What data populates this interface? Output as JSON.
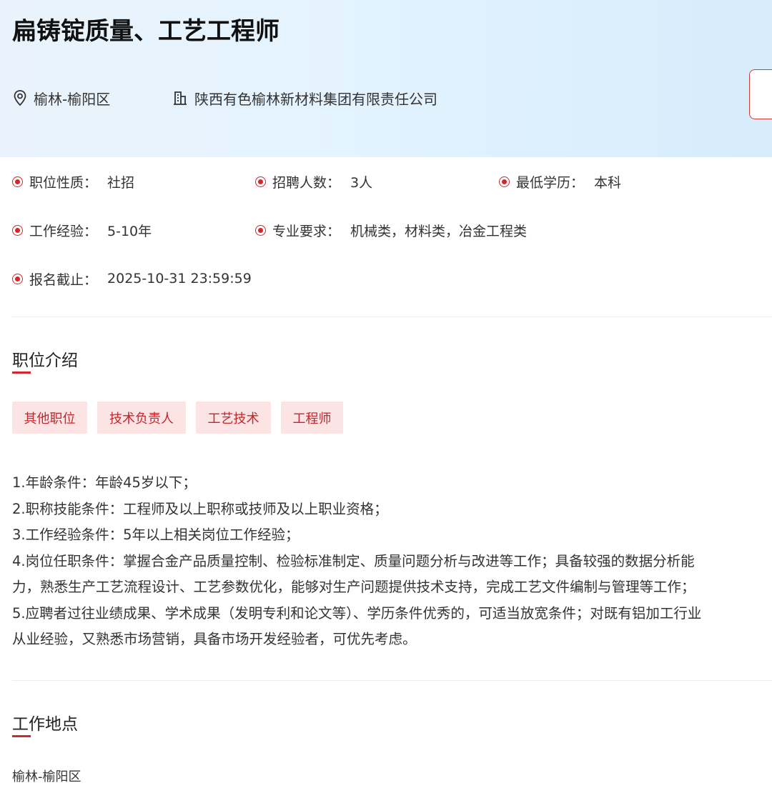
{
  "header": {
    "title": "扁铸锭质量、工艺工程师",
    "location": "榆林-榆阳区",
    "company": "陕西有色榆林新材料集团有限责任公司",
    "accent_color": "#d3272d"
  },
  "info": {
    "nature": {
      "label": "职位性质：",
      "value": "社招"
    },
    "headcount": {
      "label": "招聘人数：",
      "value": "3人"
    },
    "education": {
      "label": "最低学历：",
      "value": "本科"
    },
    "experience": {
      "label": "工作经验：",
      "value": "5-10年"
    },
    "major": {
      "label": "专业要求：",
      "value": "机械类，材料类，冶金工程类"
    },
    "deadline": {
      "label": "报名截止：",
      "value": "2025-10-31 23:59:59"
    }
  },
  "intro": {
    "title": "职位介绍",
    "tags": [
      "其他职位",
      "技术负责人",
      "工艺技术",
      "工程师"
    ],
    "lines": [
      "1.年龄条件：年龄45岁以下；",
      "2.职称技能条件：工程师及以上职称或技师及以上职业资格；",
      "3.工作经验条件：5年以上相关岗位工作经验；",
      "4.岗位任职条件：掌握合金产品质量控制、检验标准制定、质量问题分析与改进等工作；具备较强的数据分析能",
      "力，熟悉生产工艺流程设计、工艺参数优化，能够对生产问题提供技术支持，完成工艺文件编制与管理等工作；",
      "5.应聘者过往业绩成果、学术成果（发明专利和论文等）、学历条件优秀的，可适当放宽条件；对既有铝加工行业",
      "从业经验，又熟悉市场营销，具备市场开发经验者，可优先考虑。"
    ]
  },
  "workplace": {
    "title": "工作地点",
    "value": "榆林-榆阳区"
  }
}
